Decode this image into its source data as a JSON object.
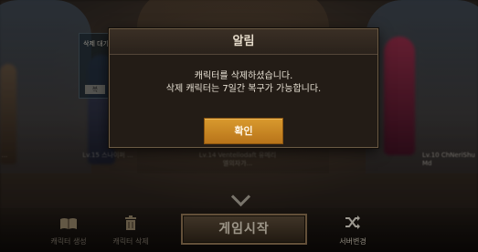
{
  "dialog": {
    "title": "알림",
    "message_line1": "캐릭터를 삭제하셨습니다.",
    "message_line2": "삭제 캐릭터는 7일간 복구가 가능합니다.",
    "confirm_label": "확인"
  },
  "background": {
    "side_card_text": "삭제 대기",
    "side_card_button": "복",
    "char_info_left": "Lv.15 스나이퍼 ...",
    "char_info_center": "Lv.14 Ventellodaft 유메리엘의자가...",
    "char_info_right": "Lv.10 ChNeriShu Md",
    "char_info_edge": "..."
  },
  "bottom_bar": {
    "create_label": "캐릭터 생성",
    "delete_label": "캐릭터 삭제",
    "start_label": "게임시작",
    "server_label": "서버변경"
  },
  "icons": {
    "create": "book-icon",
    "delete": "trash-icon",
    "server": "shuffle-icon",
    "scroll": "chevron-down-icon"
  },
  "colors": {
    "confirm_button": "#c8841f",
    "dialog_bg": "#231c16",
    "dialog_border": "#6b5a44"
  }
}
